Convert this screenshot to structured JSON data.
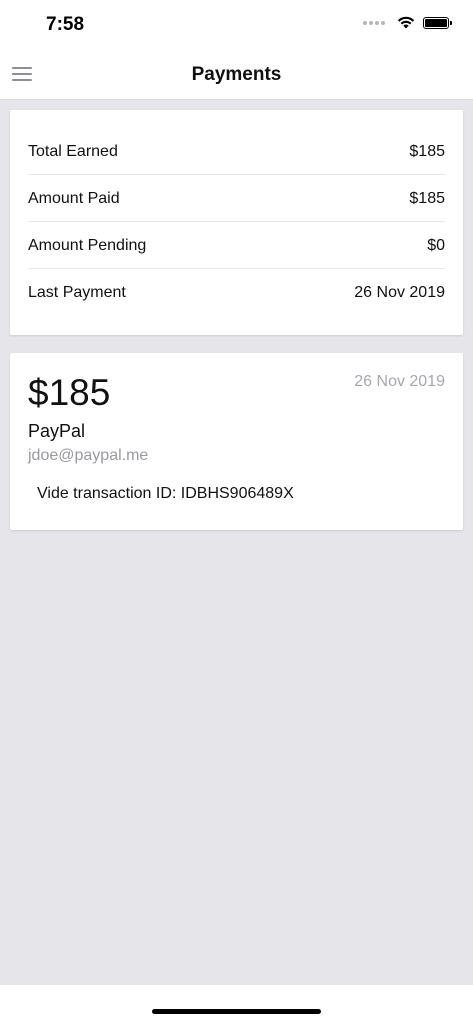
{
  "status_bar": {
    "time": "7:58"
  },
  "header": {
    "title": "Payments",
    "menu_icon": "hamburger-menu-icon"
  },
  "summary": {
    "rows": [
      {
        "label": "Total Earned",
        "value": "$185"
      },
      {
        "label": "Amount Paid",
        "value": "$185"
      },
      {
        "label": "Amount Pending",
        "value": "$0"
      },
      {
        "label": "Last Payment",
        "value": "26 Nov 2019"
      }
    ]
  },
  "payment": {
    "amount": "$185",
    "date": "26 Nov 2019",
    "method": "PayPal",
    "email": "jdoe@paypal.me",
    "transaction": "Vide transaction ID: IDBHS906489X"
  },
  "colors": {
    "background": "#e6e5ea",
    "card": "#ffffff",
    "muted_text": "#a7a7ad"
  }
}
